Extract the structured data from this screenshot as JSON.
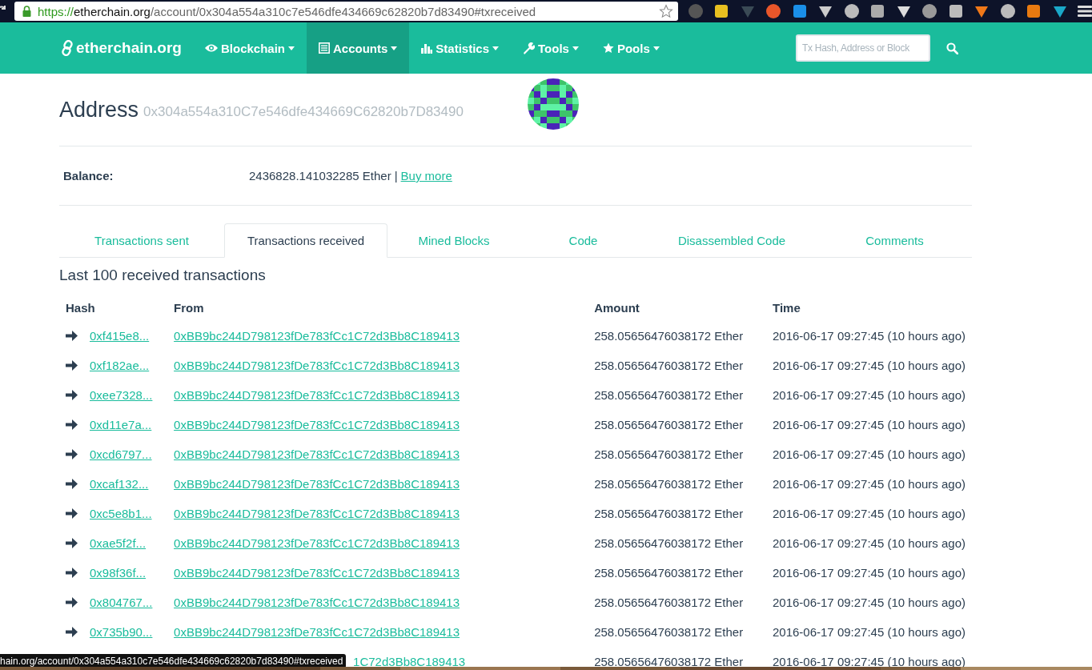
{
  "browser": {
    "url": {
      "scheme": "https://",
      "host": "etherchain.org",
      "path": "/account/0x304a554a310c7e546dfe434669c62820b7d83490#txreceived"
    }
  },
  "navbar": {
    "brand": "etherchain.org",
    "items": [
      {
        "label": "Blockchain",
        "selected": false
      },
      {
        "label": "Accounts",
        "selected": true
      },
      {
        "label": "Statistics",
        "selected": false
      },
      {
        "label": "Tools",
        "selected": false
      },
      {
        "label": "Pools",
        "selected": false
      }
    ],
    "search": {
      "placeholder": "Tx Hash, Address or Block"
    }
  },
  "address": {
    "title": "Address",
    "hash": "0x304a554a310C7e546dfe434669C62820b7D83490"
  },
  "balance": {
    "label": "Balance:",
    "value": "2436828.141032285 Ether",
    "separator": "|",
    "link": "Buy more"
  },
  "tabs": [
    {
      "label": "Transactions sent",
      "selected": false
    },
    {
      "label": "Transactions received",
      "selected": true
    },
    {
      "label": "Mined Blocks",
      "selected": false
    },
    {
      "label": "Code",
      "selected": false
    },
    {
      "label": "Disassembled Code",
      "selected": false
    },
    {
      "label": "Comments",
      "selected": false
    }
  ],
  "section_title": "Last 100 received transactions",
  "table": {
    "columns": [
      "Hash",
      "From",
      "Amount",
      "Time"
    ],
    "rows": [
      {
        "hash": "0xf415e8...",
        "from": "0xBB9bc244D798123fDe783fCc1C72d3Bb8C189413",
        "amount": "258.05656476038172 Ether",
        "time": "2016-06-17 09:27:45 (10 hours ago)"
      },
      {
        "hash": "0xf182ae...",
        "from": "0xBB9bc244D798123fDe783fCc1C72d3Bb8C189413",
        "amount": "258.05656476038172 Ether",
        "time": "2016-06-17 09:27:45 (10 hours ago)"
      },
      {
        "hash": "0xee7328...",
        "from": "0xBB9bc244D798123fDe783fCc1C72d3Bb8C189413",
        "amount": "258.05656476038172 Ether",
        "time": "2016-06-17 09:27:45 (10 hours ago)"
      },
      {
        "hash": "0xd11e7a...",
        "from": "0xBB9bc244D798123fDe783fCc1C72d3Bb8C189413",
        "amount": "258.05656476038172 Ether",
        "time": "2016-06-17 09:27:45 (10 hours ago)"
      },
      {
        "hash": "0xcd6797...",
        "from": "0xBB9bc244D798123fDe783fCc1C72d3Bb8C189413",
        "amount": "258.05656476038172 Ether",
        "time": "2016-06-17 09:27:45 (10 hours ago)"
      },
      {
        "hash": "0xcaf132...",
        "from": "0xBB9bc244D798123fDe783fCc1C72d3Bb8C189413",
        "amount": "258.05656476038172 Ether",
        "time": "2016-06-17 09:27:45 (10 hours ago)"
      },
      {
        "hash": "0xc5e8b1...",
        "from": "0xBB9bc244D798123fDe783fCc1C72d3Bb8C189413",
        "amount": "258.05656476038172 Ether",
        "time": "2016-06-17 09:27:45 (10 hours ago)"
      },
      {
        "hash": "0xae5f2f...",
        "from": "0xBB9bc244D798123fDe783fCc1C72d3Bb8C189413",
        "amount": "258.05656476038172 Ether",
        "time": "2016-06-17 09:27:45 (10 hours ago)"
      },
      {
        "hash": "0x98f36f...",
        "from": "0xBB9bc244D798123fDe783fCc1C72d3Bb8C189413",
        "amount": "258.05656476038172 Ether",
        "time": "2016-06-17 09:27:45 (10 hours ago)"
      },
      {
        "hash": "0x804767...",
        "from": "0xBB9bc244D798123fDe783fCc1C72d3Bb8C189413",
        "amount": "258.05656476038172 Ether",
        "time": "2016-06-17 09:27:45 (10 hours ago)"
      },
      {
        "hash": "0x735b90...",
        "from": "0xBB9bc244D798123fDe783fCc1C72d3Bb8C189413",
        "amount": "258.05656476038172 Ether",
        "time": "2016-06-17 09:27:45 (10 hours ago)"
      },
      {
        "from": "1C72d3Bb8C189413",
        "amount": "258.05656476038172 Ether",
        "time": "2016-06-17 09:27:45 (10 hours ago)"
      }
    ]
  },
  "status_tooltip": "hain.org/account/0x304a554a310c7e546dfe434669c62820b7d83490#txreceived"
}
